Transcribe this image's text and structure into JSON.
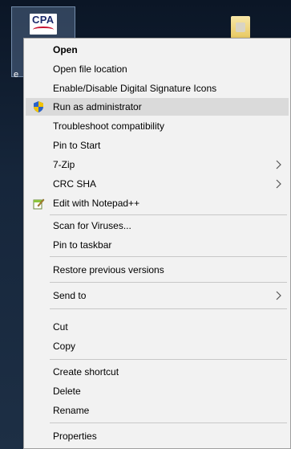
{
  "desktop": {
    "icon_logo_text": "CPA",
    "icon_label": "e"
  },
  "menu": {
    "items": [
      {
        "id": "open",
        "label": "Open"
      },
      {
        "id": "open-file-location",
        "label": "Open file location"
      },
      {
        "id": "enable-disable-signature",
        "label": "Enable/Disable Digital Signature Icons"
      },
      {
        "id": "run-as-admin",
        "label": "Run as administrator",
        "icon": "shield-icon"
      },
      {
        "id": "troubleshoot",
        "label": "Troubleshoot compatibility"
      },
      {
        "id": "pin-to-start",
        "label": "Pin to Start"
      },
      {
        "id": "7zip",
        "label": "7-Zip"
      },
      {
        "id": "crc-sha",
        "label": "CRC SHA"
      },
      {
        "id": "edit-notepadpp",
        "label": "Edit with Notepad++",
        "icon": "notepad-icon"
      },
      {
        "id": "scan-viruses",
        "label": "Scan for Viruses..."
      },
      {
        "id": "pin-taskbar",
        "label": "Pin to taskbar"
      },
      {
        "id": "restore-versions",
        "label": "Restore previous versions"
      },
      {
        "id": "send-to",
        "label": "Send to"
      },
      {
        "id": "cut",
        "label": "Cut"
      },
      {
        "id": "copy",
        "label": "Copy"
      },
      {
        "id": "create-shortcut",
        "label": "Create shortcut"
      },
      {
        "id": "delete",
        "label": "Delete"
      },
      {
        "id": "rename",
        "label": "Rename"
      },
      {
        "id": "properties",
        "label": "Properties"
      }
    ]
  },
  "colors": {
    "menu_bg": "#f2f2f2",
    "hover_bg": "#dadada",
    "separator": "#c8c8c8"
  }
}
